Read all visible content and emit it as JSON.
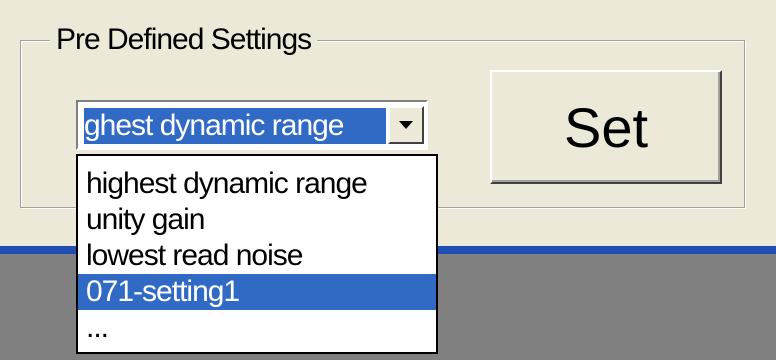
{
  "group": {
    "title": "Pre Defined Settings"
  },
  "combo": {
    "value": "ghest dynamic range",
    "arrow_icon": "chevron-down-icon"
  },
  "set_button": {
    "label": "Set"
  },
  "dropdown": {
    "items": [
      {
        "label": "highest dynamic range",
        "selected": false
      },
      {
        "label": "unity gain",
        "selected": false
      },
      {
        "label": "lowest read noise",
        "selected": false
      },
      {
        "label": "071-setting1",
        "selected": true
      },
      {
        "label": "...",
        "selected": false
      }
    ]
  },
  "colors": {
    "window_bg": "#ece9d8",
    "selection": "#316ac5",
    "bottom_band": "#808080",
    "blue_line": "#1f4fb3"
  }
}
